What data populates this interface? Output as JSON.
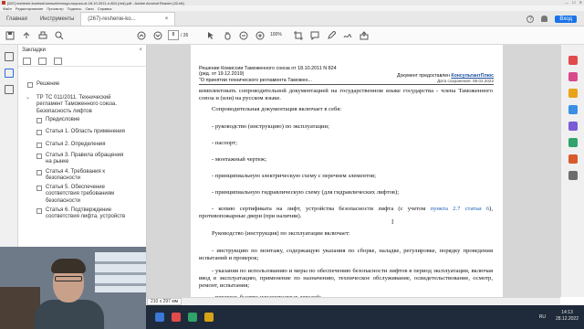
{
  "window": {
    "title": "[267] reshenie-komissii-tamozhennogo-soyuza-ot-18.10.2011-n-824 (red).pdf - Adobe Acrobat Reader (32-bit)",
    "controls": [
      "—",
      "☐",
      "✕"
    ]
  },
  "menu": [
    "Файл",
    "Редактирование",
    "Просмотр",
    "Подпись",
    "Окно",
    "Справка"
  ],
  "tabs": {
    "home": "Главная",
    "tools": "Инструменты",
    "document": "(267)-reshenie-ko...",
    "close": "×",
    "signin": "Вход"
  },
  "toolbar": {
    "current_page": "8",
    "page_count": "/ 26",
    "zoom": "100%",
    "icons": [
      "save-icon",
      "upload-icon",
      "print-icon",
      "search-icon",
      "page-up-icon",
      "page-down-icon",
      "cursor-icon",
      "hand-icon",
      "zoom-out-icon",
      "zoom-in-icon",
      "crop-icon",
      "comment-icon",
      "pen-icon",
      "sign-icon",
      "share-icon"
    ]
  },
  "bookmarks": {
    "header": "Закладки",
    "close": "×",
    "items": [
      {
        "label": "Решение",
        "level": 0
      },
      {
        "label": "ТР ТС 011/2011. Технический регламент Таможенного союза. Безопасность лифтов",
        "level": 0
      },
      {
        "label": "Предисловие",
        "level": 1
      },
      {
        "label": "Статья 1. Область применения",
        "level": 1
      },
      {
        "label": "Статья 2. Определения",
        "level": 1
      },
      {
        "label": "Статья 3. Правила обращения на рынке",
        "level": 1
      },
      {
        "label": "Статья 4. Требования к безопасности",
        "level": 1
      },
      {
        "label": "Статья 5. Обеспечение соответствия требованиям безопасности",
        "level": 1
      },
      {
        "label": "Статья 6. Подтверждение соответствия лифта, устройств",
        "level": 1
      }
    ]
  },
  "document": {
    "header_left": [
      "Решение Комиссии Таможенного союза от 18.10.2011 N 824",
      "(ред. от 19.12.2019)",
      "\"О принятии технического регламента Таможен..."
    ],
    "header_right_prefix": "Документ предоставлен ",
    "header_right_brand": "КонсультантПлюс",
    "saved": "Дата сохранения: 08.02.2022",
    "p1": "комплектовать сопроводительной документацией на государственном языке государства - члена Таможенного союза и (или) на русском языке.",
    "p2": "Сопроводительная документация включает в себя:",
    "p3": "- руководство (инструкцию) по эксплуатации;",
    "p4": "- паспорт;",
    "p5": "- монтажный чертеж;",
    "p6": "- принципиальную электрическую схему с перечнем элементов;",
    "p7": "- принципиальную гидравлическую схему (для гидравлических лифтов);",
    "p8a": "- копию сертификата на лифт, устройства безопасности лифта (с учетом ",
    "p8link": "пункта 2.7 статьи 6",
    "p8b": "), противопожарные двери (при наличии).",
    "p9": "Руководство (инструкция) по эксплуатации включает:",
    "p10": "- инструкцию по монтажу, содержащую указания по сборке, наладке, регулировке, порядку проведения испытаний и проверок;",
    "p11": "- указания по использованию и меры по обеспечению безопасности лифтов в период эксплуатации, включая ввод в эксплуатацию, применение по назначению, техническое обслуживание, освидетельствование, осмотр, ремонт, испытания;",
    "p12": "- перечень быстро изнашиваемых деталей;"
  },
  "status": {
    "dims": "210 x 297 мм"
  },
  "taskbar": {
    "lang": "RU",
    "time": "14:13",
    "date": "28.12.2022"
  },
  "colors": {
    "accent": "#1a73e8",
    "link": "#1a5fb4",
    "brand": "#1a4fa0",
    "taskbar": "#1f2a3a"
  }
}
